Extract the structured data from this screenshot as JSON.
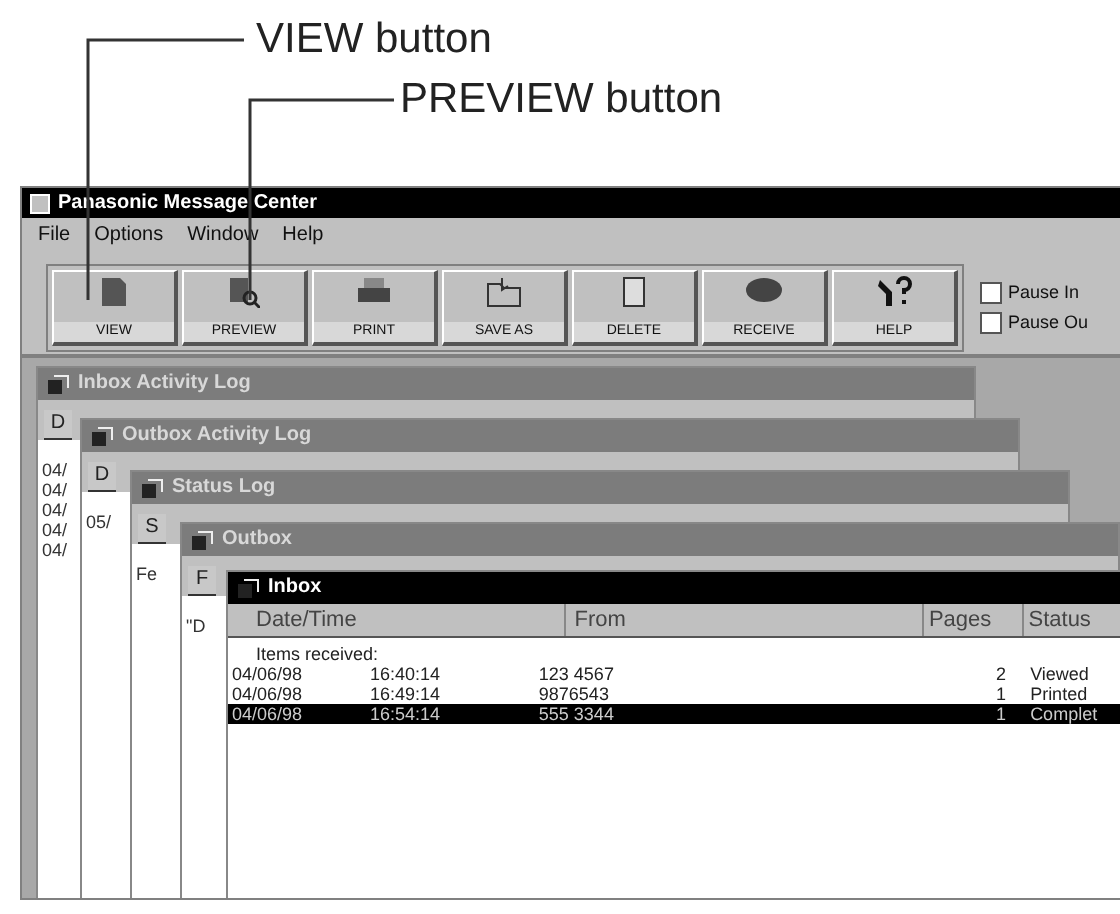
{
  "callouts": [
    {
      "text": "VIEW button"
    },
    {
      "text": "PREVIEW button"
    }
  ],
  "window": {
    "title": "Panasonic Message Center"
  },
  "menu": [
    "File",
    "Options",
    "Window",
    "Help"
  ],
  "toolbar": [
    "VIEW",
    "PREVIEW",
    "PRINT",
    "SAVE AS",
    "DELETE",
    "RECEIVE",
    "HELP"
  ],
  "checkboxes": [
    {
      "label": "Pause In",
      "checked": false
    },
    {
      "label": "Pause Ou",
      "checked": false
    }
  ],
  "child_windows": [
    {
      "title": "Inbox Activity Log",
      "active": false,
      "column_1": "D",
      "rows": [
        "04/",
        "04/",
        "04/",
        "04/",
        "04/"
      ]
    },
    {
      "title": "Outbox Activity Log",
      "active": false,
      "column_1": "D",
      "rows": [
        "05/"
      ]
    },
    {
      "title": "Status Log",
      "active": false,
      "column_1": "S",
      "rows": [
        "Fe"
      ]
    },
    {
      "title": "Outbox",
      "active": false,
      "column_1": "F",
      "rows": [
        "\"D"
      ]
    }
  ],
  "inbox": {
    "title": "Inbox",
    "active": true,
    "columns": [
      "Date/Time",
      "From",
      "Pages",
      "Status"
    ],
    "group_label": "Items received:",
    "rows": [
      {
        "date": "04/06/98",
        "time": "16:40:14",
        "from": "123 4567",
        "pages": "2",
        "status": "Viewed",
        "selected": false
      },
      {
        "date": "04/06/98",
        "time": "16:49:14",
        "from": "9876543",
        "pages": "1",
        "status": "Printed",
        "selected": false
      },
      {
        "date": "04/06/98",
        "time": "16:54:14",
        "from": "555 3344",
        "pages": "1",
        "status": "Complet",
        "selected": true
      }
    ]
  }
}
